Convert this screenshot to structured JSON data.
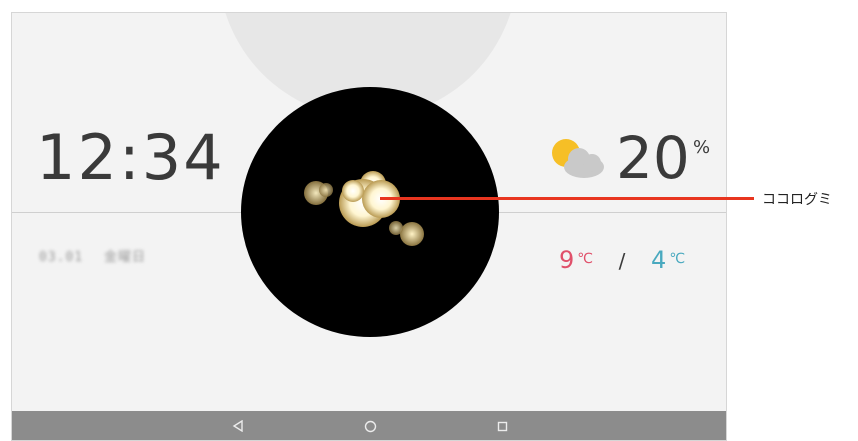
{
  "screen": {
    "time": "12:34",
    "date_blurred": [
      "03.01",
      "金曜日"
    ],
    "weather": {
      "icon": "partly-cloudy-icon",
      "value": "20",
      "unit": "%",
      "high": "9",
      "low": "4",
      "temp_unit": "℃",
      "separator": "/"
    }
  },
  "navbar": {
    "back_icon": "back-triangle-icon",
    "home_icon": "home-circle-icon",
    "recents_icon": "recents-square-icon"
  },
  "callout": {
    "label": "ココログミ"
  },
  "colors": {
    "screen_bg": "#f3f3f3",
    "circle": "#000000",
    "high_temp": "#e0506a",
    "low_temp": "#49a9bf",
    "callout_line": "#e8351f",
    "navbar": "#8c8c8c"
  }
}
